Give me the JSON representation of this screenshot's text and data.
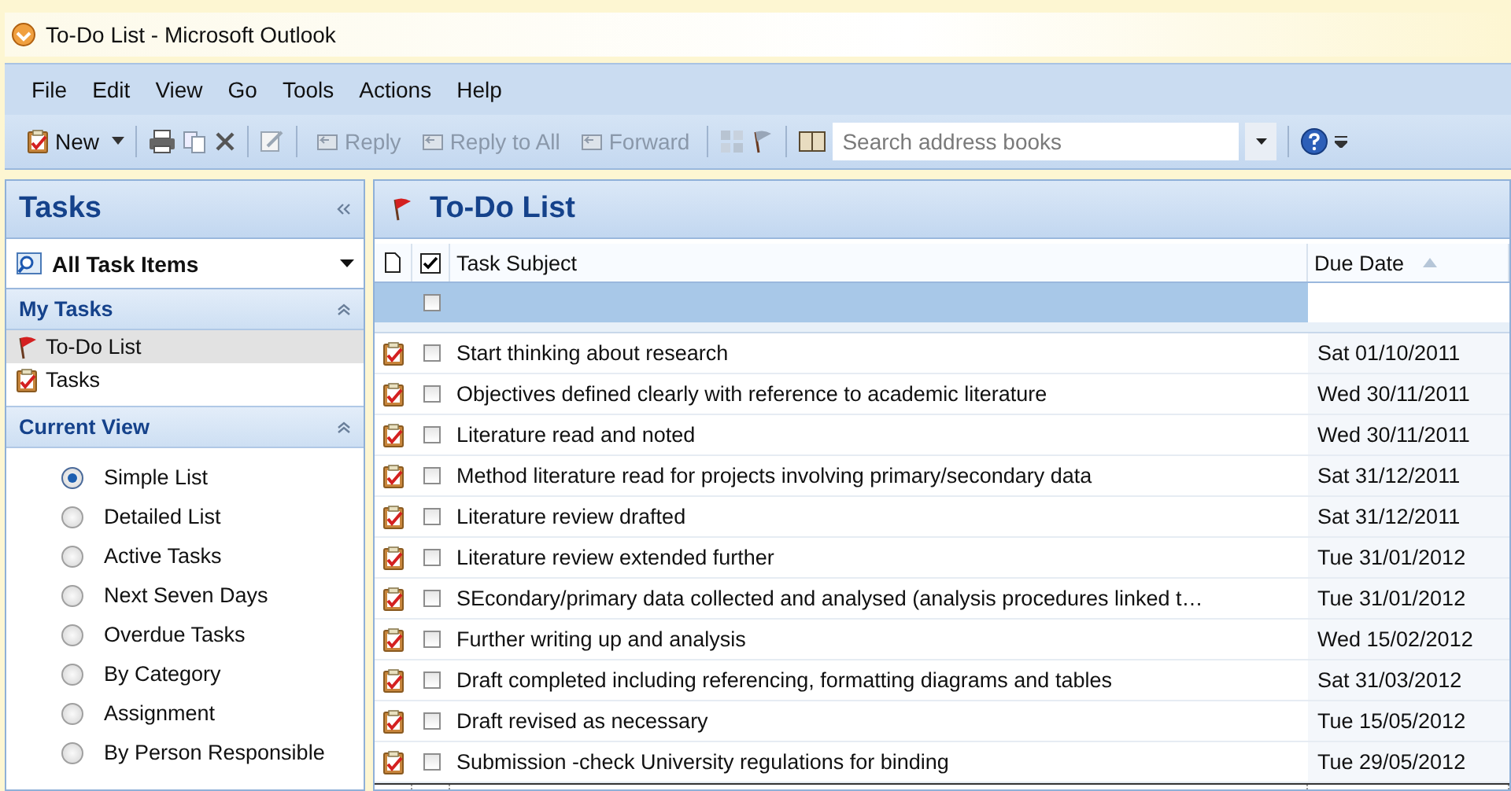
{
  "window": {
    "title": "To-Do List - Microsoft Outlook"
  },
  "menu": [
    "File",
    "Edit",
    "View",
    "Go",
    "Tools",
    "Actions",
    "Help"
  ],
  "toolbar": {
    "new_button": {
      "label": "New",
      "disabled": false
    },
    "reply_buttons": [
      {
        "label": "Reply",
        "disabled": true
      },
      {
        "label": "Reply to All",
        "disabled": true
      },
      {
        "label": "Forward",
        "disabled": true
      }
    ],
    "search": {
      "placeholder": "Search address books"
    }
  },
  "sidebar": {
    "title": "Tasks",
    "view_selector": "All Task Items",
    "my_tasks": {
      "title": "My Tasks",
      "items": [
        {
          "label": "To-Do List",
          "kind": "flag",
          "selected": true
        },
        {
          "label": "Tasks",
          "kind": "task",
          "selected": false
        }
      ]
    },
    "current_view": {
      "title": "Current View",
      "items": [
        {
          "label": "Simple List",
          "selected": true
        },
        {
          "label": "Detailed List",
          "selected": false
        },
        {
          "label": "Active Tasks",
          "selected": false
        },
        {
          "label": "Next Seven Days",
          "selected": false
        },
        {
          "label": "Overdue Tasks",
          "selected": false
        },
        {
          "label": "By Category",
          "selected": false
        },
        {
          "label": "Assignment",
          "selected": false
        },
        {
          "label": "By Person Responsible",
          "selected": false
        }
      ]
    }
  },
  "main": {
    "title": "To-Do List",
    "columns": [
      "Task Subject",
      "Due Date"
    ],
    "new_item": {
      "completed": false
    },
    "rows": [
      {
        "subject": "Start thinking about research",
        "due": "Sat 01/10/2011",
        "completed": false
      },
      {
        "subject": "Objectives defined clearly with reference to academic literature",
        "due": "Wed 30/11/2011",
        "completed": false
      },
      {
        "subject": "Literature read and noted",
        "due": "Wed 30/11/2011",
        "completed": false
      },
      {
        "subject": "Method literature read for projects involving primary/secondary data",
        "due": "Sat 31/12/2011",
        "completed": false
      },
      {
        "subject": "Literature review drafted",
        "due": "Sat 31/12/2011",
        "completed": false
      },
      {
        "subject": "Literature review extended further",
        "due": "Tue 31/01/2012",
        "completed": false
      },
      {
        "subject": "SEcondary/primary data collected and analysed (analysis procedures linked t…",
        "due": "Tue 31/01/2012",
        "completed": false
      },
      {
        "subject": "Further writing up and analysis",
        "due": "Wed 15/02/2012",
        "completed": false
      },
      {
        "subject": "Draft completed including referencing, formatting diagrams and tables",
        "due": "Sat 31/03/2012",
        "completed": false
      },
      {
        "subject": "Draft revised as necessary",
        "due": "Tue 15/05/2012",
        "completed": false
      },
      {
        "subject": "Submission -check University regulations for binding",
        "due": "Tue 29/05/2012",
        "completed": false
      }
    ]
  }
}
